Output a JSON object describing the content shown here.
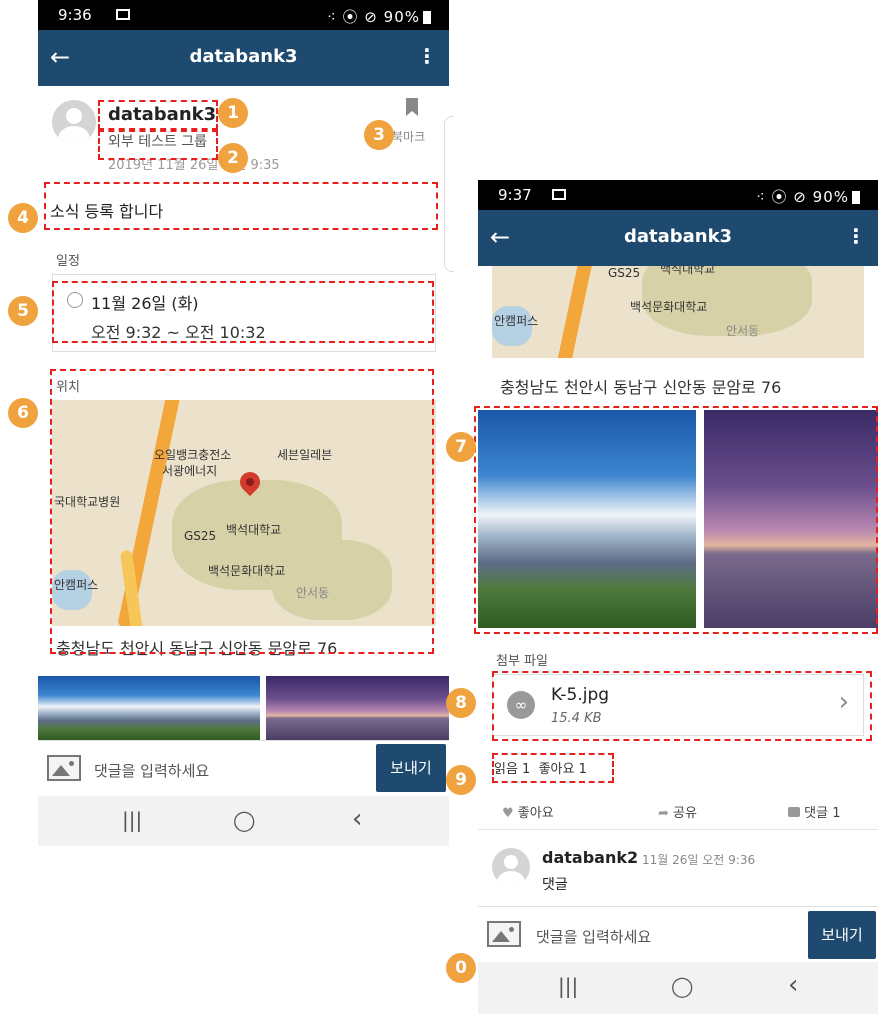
{
  "screen1": {
    "status": {
      "time": "9:36",
      "right": "⁖ ⦿ ⊘ 90%"
    },
    "appbar": {
      "title": "databank3",
      "back": "←",
      "menu": "⋮"
    },
    "post": {
      "author": "databank3",
      "group": "외부 테스트 그룹",
      "date": "2019년 11월 26일 오전 9:35",
      "bookmark_label": "북마크",
      "content": "소식 등록 합니다"
    },
    "schedule": {
      "label": "일정",
      "date": "11월 26일 (화)",
      "time": "오전 9:32 ~ 오전 10:32"
    },
    "location": {
      "label": "위치",
      "address": "충청남도 천안시 동남구 신안동 문암로 76",
      "map_labels": [
        "오일뱅크충전소",
        "서광에너지",
        "세븐일레븐",
        "국대학교병원",
        "GS25",
        "백석대학교",
        "백석문화대학교",
        "안캠퍼스",
        "안서동"
      ]
    },
    "comment_bar": {
      "placeholder": "댓글을 입력하세요",
      "send": "보내기"
    },
    "nav": {
      "recent": "|||",
      "home": "◯",
      "back": "‹"
    }
  },
  "screen2": {
    "status": {
      "time": "9:37",
      "right": "⁖ ⦿ ⊘ 90%"
    },
    "appbar": {
      "title": "databank3",
      "back": "←",
      "menu": "⋮"
    },
    "location": {
      "address": "충청남도 천안시 동남구 신안동 문암로 76",
      "map_labels": [
        "GS25",
        "백석대학교",
        "백석문화대학교",
        "안캠퍼스",
        "안서동"
      ]
    },
    "attachments": {
      "label": "첨부 파일",
      "file_name": "K-5.jpg",
      "file_size": "15.4 KB"
    },
    "stats": {
      "text": "읽음 1  좋아요 1"
    },
    "actions": {
      "like": "좋아요",
      "share": "공유",
      "comment": "댓글 1"
    },
    "comment": {
      "author": "databank2",
      "date": "11월 26일 오전 9:36",
      "text": "댓글"
    },
    "comment_bar": {
      "placeholder": "댓글을 입력하세요",
      "send": "보내기"
    },
    "nav": {
      "recent": "|||",
      "home": "◯",
      "back": "‹"
    }
  },
  "badges": [
    "1",
    "2",
    "3",
    "4",
    "5",
    "6",
    "7",
    "8",
    "9",
    "0"
  ],
  "colors": {
    "appbar": "#1d4a6e",
    "badge": "#f0a23e",
    "dash": "#e8201d"
  }
}
